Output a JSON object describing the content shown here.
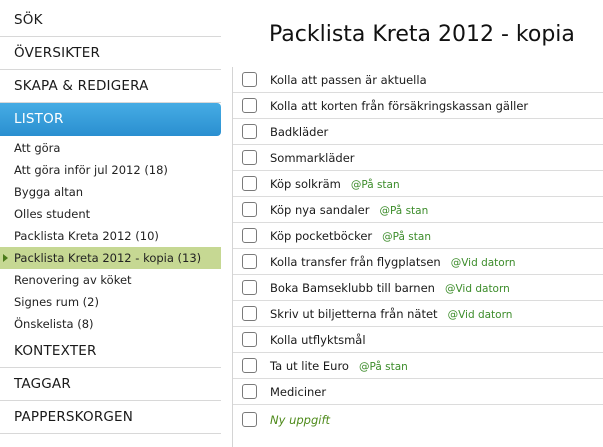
{
  "sidebar": {
    "sections": {
      "search": "SÖK",
      "overviews": "ÖVERSIKTER",
      "create_edit": "SKAPA & REDIGERA",
      "lists": "LISTOR",
      "contexts": "KONTEXTER",
      "tags": "TAGGAR",
      "trash": "PAPPERSKORGEN"
    },
    "list_items": [
      "Att göra",
      "Att göra inför jul 2012 (18)",
      "Bygga altan",
      "Olles student",
      "Packlista Kreta 2012 (10)",
      "Packlista Kreta 2012 - kopia (13)",
      "Renovering av köket",
      "Signes rum (2)",
      "Önskelista (8)"
    ],
    "selected_list": "Packlista Kreta 2012 - kopia (13)"
  },
  "main": {
    "title": "Packlista Kreta 2012 - kopia",
    "tasks": [
      {
        "text": "Kolla att passen är aktuella",
        "context": ""
      },
      {
        "text": "Kolla att korten från försäkringskassan gäller",
        "context": ""
      },
      {
        "text": "Badkläder",
        "context": ""
      },
      {
        "text": "Sommarkläder",
        "context": ""
      },
      {
        "text": "Köp solkräm",
        "context": "@På stan"
      },
      {
        "text": "Köp nya sandaler",
        "context": "@På stan"
      },
      {
        "text": "Köp pocketböcker",
        "context": "@På stan"
      },
      {
        "text": "Kolla transfer från flygplatsen",
        "context": "@Vid datorn"
      },
      {
        "text": "Boka Bamseklubb till barnen",
        "context": "@Vid datorn"
      },
      {
        "text": "Skriv ut biljetterna från nätet",
        "context": "@Vid datorn"
      },
      {
        "text": "Kolla utflyktsmål",
        "context": ""
      },
      {
        "text": "Ta ut lite Euro",
        "context": "@På stan"
      },
      {
        "text": "Mediciner",
        "context": ""
      }
    ],
    "new_task": "Ny uppgift"
  },
  "colors": {
    "active_section": "#2f98d6",
    "selected_list": "#c6d893",
    "context_tag": "#3c8c2a",
    "new_task": "#4e8a1a"
  }
}
